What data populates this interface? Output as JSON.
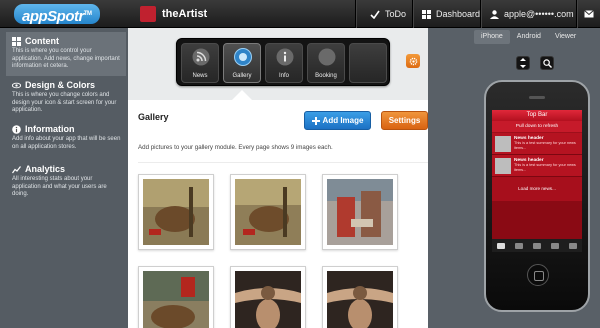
{
  "header": {
    "logo_text": "appSpotr",
    "logo_tm": "TM",
    "app_name": "theArtist",
    "todo_label": "ToDo",
    "dashboard_label": "Dashboard",
    "account_email": "apple@••••••.com"
  },
  "sidebar": {
    "items": [
      {
        "title": "Content",
        "desc": "This is where you control your application. Add news, change important information et cetera.",
        "icon": "grid-icon"
      },
      {
        "title": "Design & Colors",
        "desc": "This is where you change colors and design your icon & start screen for your application.",
        "icon": "eye-icon"
      },
      {
        "title": "Information",
        "desc": "Add info about your app that will be seen on all application stores.",
        "icon": "info-icon"
      },
      {
        "title": "Analytics",
        "desc": "All interesting stats about your application and what your users are doing.",
        "icon": "chart-icon"
      }
    ]
  },
  "modules": [
    {
      "label": "News",
      "icon": "rss-icon"
    },
    {
      "label": "Gallery",
      "icon": "gallery-icon"
    },
    {
      "label": "Info",
      "icon": "info-icon"
    },
    {
      "label": "Booking",
      "icon": "booking-icon"
    },
    {
      "label": "",
      "icon": "empty-slot"
    }
  ],
  "gallery": {
    "title": "Gallery",
    "add_image_label": "Add Image",
    "settings_label": "Settings",
    "description": "Add pictures to your gallery module. Every page shows 9 images each."
  },
  "preview": {
    "tabs": [
      "iPhone",
      "Android",
      "Viewer"
    ],
    "active_tab": "iPhone",
    "screen": {
      "top_bar": "Top Bar",
      "pull_text": "Pull down to refresh",
      "news": [
        {
          "header": "News header",
          "summary": "This is a test summary for your news items..."
        },
        {
          "header": "News header",
          "summary": "This is a test summary for your news items..."
        }
      ],
      "load_more": "Load more news..."
    }
  },
  "colors": {
    "accent_blue": "#2585cc",
    "accent_orange": "#e06f18",
    "brand_red": "#c0212f"
  }
}
